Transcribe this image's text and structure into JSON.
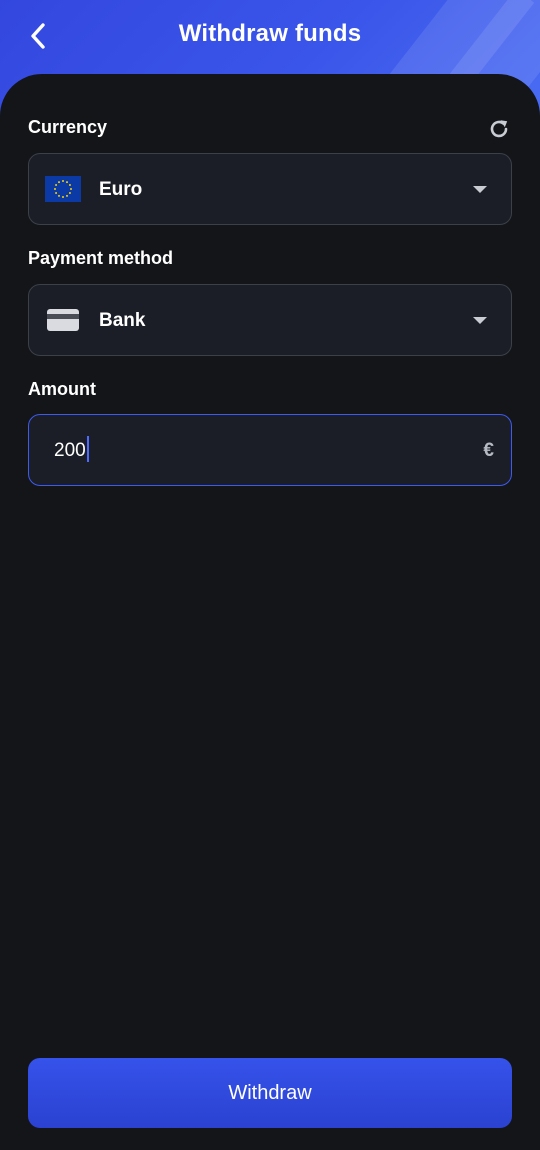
{
  "header": {
    "title": "Withdraw funds",
    "back_icon": "chevron-left-icon"
  },
  "currency": {
    "label": "Currency",
    "refresh_icon": "refresh-icon",
    "selected": "Euro",
    "flag_icon": "eu-flag-icon"
  },
  "payment_method": {
    "label": "Payment method",
    "selected": "Bank",
    "card_icon": "credit-card-icon"
  },
  "amount": {
    "label": "Amount",
    "value": "200",
    "currency_symbol": "€"
  },
  "actions": {
    "withdraw_label": "Withdraw"
  },
  "colors": {
    "accent": "#3a55ea",
    "background": "#131519",
    "field_bg": "#1b1e26",
    "field_border": "#3c4049",
    "active_border": "#3d5bf0",
    "eu_blue": "#0b3aa6",
    "eu_star": "#f5d000"
  }
}
